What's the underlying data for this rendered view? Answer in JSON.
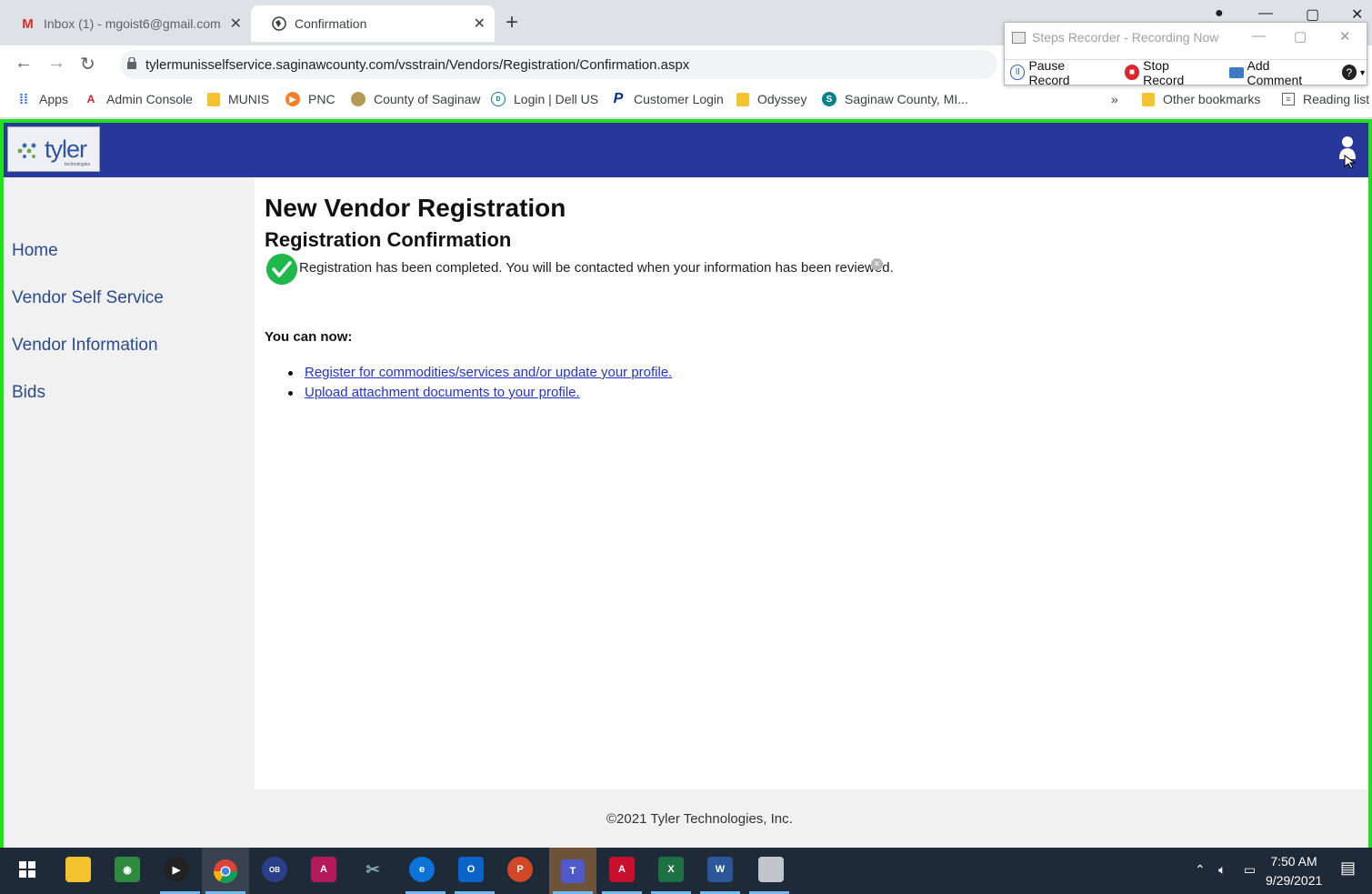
{
  "browser": {
    "tabs": [
      {
        "title": "Inbox (1) - mgoist6@gmail.com",
        "icon": "gmail-icon",
        "active": false
      },
      {
        "title": "Confirmation",
        "icon": "globe-icon",
        "active": true
      }
    ],
    "address": "tylermunisselfservice.saginawcounty.com/vsstrain/Vendors/Registration/Confirmation.aspx",
    "bookmarks": [
      {
        "label": "Apps",
        "icon": "apps-grid-icon"
      },
      {
        "label": "Admin Console",
        "icon": "adobe-icon"
      },
      {
        "label": "MUNIS",
        "icon": "folder-icon"
      },
      {
        "label": "PNC",
        "icon": "pnc-icon"
      },
      {
        "label": "County of Saginaw",
        "icon": "county-seal-icon"
      },
      {
        "label": "Login | Dell US",
        "icon": "dell-icon"
      },
      {
        "label": "Customer Login",
        "icon": "paypal-icon"
      },
      {
        "label": "Odyssey",
        "icon": "folder-icon"
      },
      {
        "label": "Saginaw County, MI...",
        "icon": "sharepoint-icon"
      }
    ],
    "overflow": "»",
    "other_bookmarks": "Other bookmarks",
    "reading_list": "Reading list"
  },
  "steps_recorder": {
    "title": "Steps Recorder - Recording Now",
    "pause": "Pause Record",
    "stop": "Stop Record",
    "comment": "Add Comment"
  },
  "app": {
    "logo_text": "tyler",
    "logo_sub": "technologies",
    "nav": [
      "Home",
      "Vendor Self Service",
      "Vendor Information",
      "Bids"
    ],
    "heading": "New Vendor Registration",
    "subheading": "Registration Confirmation",
    "message": "Registration has been completed. You will be contacted when your information has been reviewed.",
    "you_can_now": "You can now:",
    "links": [
      "Register for commodities/services and/or update your profile.",
      "Upload attachment documents to your profile."
    ],
    "footer": "©2021 Tyler Technologies, Inc."
  },
  "taskbar": {
    "time": "7:50 AM",
    "date": "9/29/2021"
  },
  "colors": {
    "header": "#27379a",
    "frame_border": "#22e01e",
    "link": "#2333cc",
    "success": "#1fb84a"
  }
}
